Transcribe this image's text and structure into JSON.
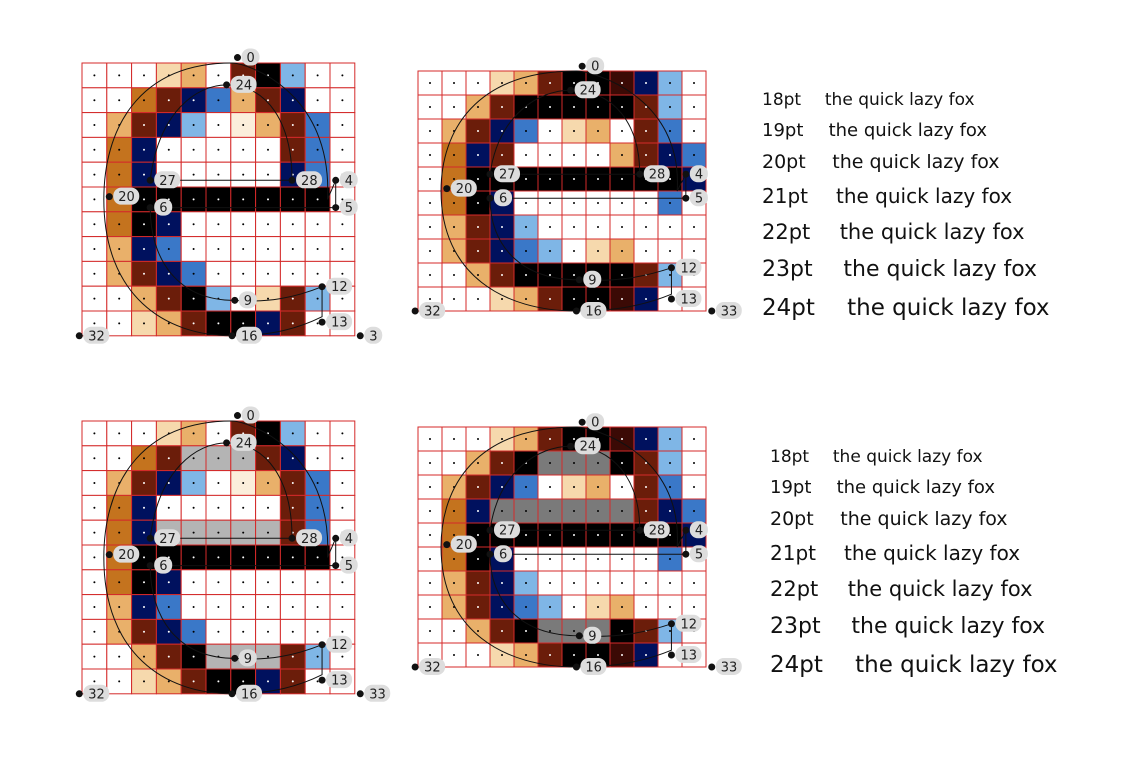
{
  "panels": [
    {
      "id": "top-left",
      "point_labels": [
        "0",
        "24",
        "27",
        "28",
        "4",
        "20",
        "6",
        "5",
        "12",
        "9",
        "13",
        "16",
        "32",
        "3"
      ]
    },
    {
      "id": "top-right",
      "point_labels": [
        "0",
        "24",
        "27",
        "28",
        "4",
        "20",
        "6",
        "5",
        "12",
        "9",
        "13",
        "16",
        "32",
        "33"
      ]
    },
    {
      "id": "bottom-left",
      "point_labels": [
        "0",
        "24",
        "27",
        "28",
        "4",
        "20",
        "6",
        "5",
        "12",
        "9",
        "13",
        "16",
        "32",
        "33"
      ]
    },
    {
      "id": "bottom-right",
      "point_labels": [
        "0",
        "24",
        "27",
        "28",
        "4",
        "20",
        "6",
        "5",
        "12",
        "9",
        "13",
        "16",
        "32",
        "33"
      ]
    }
  ],
  "text_samples": [
    {
      "id": "top",
      "rows": [
        {
          "size": "18pt",
          "text": "the quick lazy fox"
        },
        {
          "size": "19pt",
          "text": "the quick lazy fox"
        },
        {
          "size": "20pt",
          "text": "the quick lazy fox"
        },
        {
          "size": "21pt",
          "text": "the quick lazy fox"
        },
        {
          "size": "22pt",
          "text": "the quick lazy fox"
        },
        {
          "size": "23pt",
          "text": "the quick lazy fox"
        },
        {
          "size": "24pt",
          "text": "the quick lazy fox"
        }
      ]
    },
    {
      "id": "bottom",
      "rows": [
        {
          "size": "18pt",
          "text": "the quick lazy fox"
        },
        {
          "size": "19pt",
          "text": "the quick lazy fox"
        },
        {
          "size": "20pt",
          "text": "the quick lazy fox"
        },
        {
          "size": "21pt",
          "text": "the quick lazy fox"
        },
        {
          "size": "22pt",
          "text": "the quick lazy fox"
        },
        {
          "size": "23pt",
          "text": "the quick lazy fox"
        },
        {
          "size": "24pt",
          "text": "the quick lazy fox"
        }
      ]
    }
  ],
  "colors": {
    "grid_line": "#d42a2a",
    "outline": "#111111",
    "label_bg": "#dddddd",
    "ink_black": "#000000",
    "ink_navy": "#00115e",
    "ink_brown": "#6b1d0a"
  }
}
